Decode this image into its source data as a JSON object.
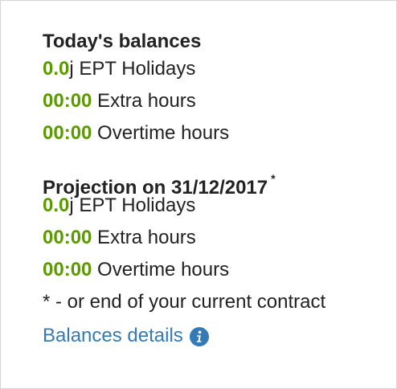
{
  "today": {
    "title": "Today's balances",
    "rows": [
      {
        "value": "0.0",
        "unit": "j",
        "label": " EPT Holidays"
      },
      {
        "value": "00:00",
        "unit": "",
        "label": " Extra hours"
      },
      {
        "value": "00:00",
        "unit": "",
        "label": " Overtime hours"
      }
    ]
  },
  "projection": {
    "title": "Projection on 31/12/2017",
    "marker": "*",
    "rows": [
      {
        "value": "0.0",
        "unit": "j",
        "label": " EPT Holidays"
      },
      {
        "value": "00:00",
        "unit": "",
        "label": " Extra hours"
      },
      {
        "value": "00:00",
        "unit": "",
        "label": " Overtime hours"
      }
    ],
    "footnote": "* - or end of your current contract"
  },
  "details_link": {
    "label": "Balances details",
    "icon": "info-icon"
  },
  "colors": {
    "value_green": "#5a9a00",
    "link_blue": "#337ab7",
    "text": "#222222",
    "border": "#d4d4d4"
  }
}
